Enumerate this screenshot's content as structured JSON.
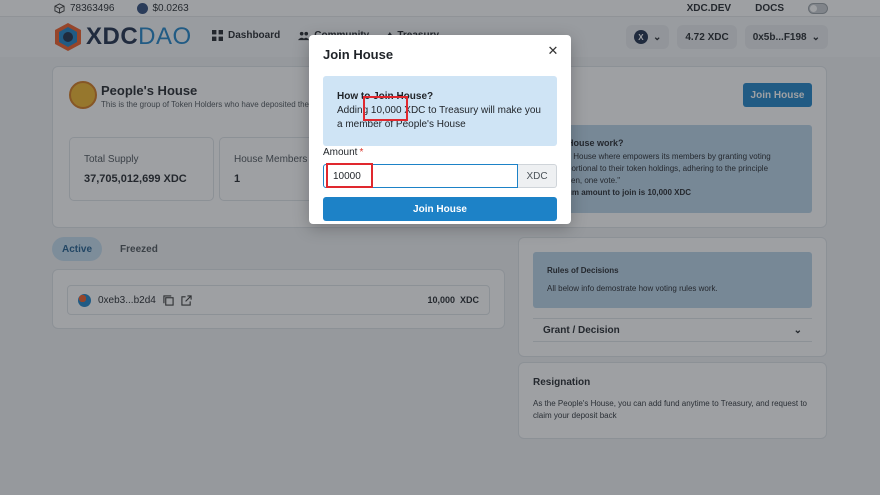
{
  "topbar": {
    "block_number": "78363496",
    "price": "$0.0263",
    "links": [
      "XDC.DEV",
      "DOCS"
    ]
  },
  "header": {
    "logo_main": "XDC",
    "logo_accent": "DAO",
    "nav": [
      "Dashboard",
      "Community",
      "Treasury"
    ],
    "network_badge": "X",
    "balance": "4.72 XDC",
    "account": "0x5b...F198"
  },
  "house": {
    "title": "People's House",
    "description": "This is the group of Token Holders who have deposited their to",
    "join_button": "Join House",
    "stats": [
      {
        "label": "Total Supply",
        "value": "37,705,012,699 XDC"
      },
      {
        "label": "House Members",
        "value": "1"
      }
    ],
    "info": {
      "title": "House work?",
      "lines": [
        "s House where empowers its members by granting voting",
        "portional to their token holdings, adhering to the principle",
        "ken, one vote.\"",
        "um amount to join is 10,000 XDC"
      ]
    }
  },
  "tabs": [
    "Active",
    "Freezed"
  ],
  "members": [
    {
      "address": "0xeb3...b2d4",
      "amount": "10,000",
      "unit": "XDC"
    }
  ],
  "rules": {
    "title": "Rules of Decisions",
    "description": "All below info demostrate how voting rules work.",
    "accordion": "Grant / Decision"
  },
  "resignation": {
    "title": "Resignation",
    "description": "As the People's House, you can add fund anytime to Treasury, and request to claim your deposit back"
  },
  "modal": {
    "title": "Join House",
    "info_title": "How to Join House?",
    "info_text": "Adding 10,000 XDC to Treasury will make you a member of People's House",
    "amount_label": "Amount",
    "required_mark": "*",
    "amount_value": "10000",
    "amount_suffix": "XDC",
    "submit_label": "Join House",
    "close_glyph": "✕"
  },
  "colors": {
    "brand": "#1d82c7",
    "highlight": "#e0282e",
    "info_bg": "#cfe4f5"
  }
}
